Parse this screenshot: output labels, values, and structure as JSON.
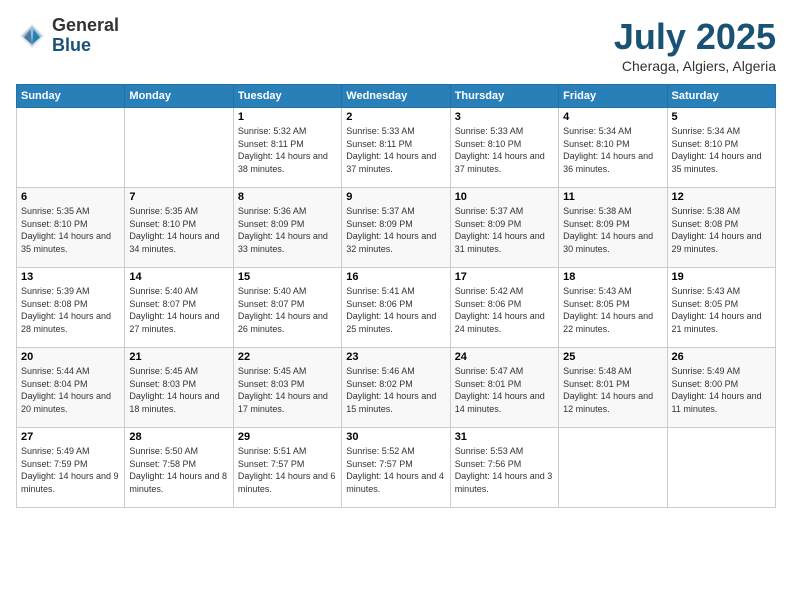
{
  "logo": {
    "general": "General",
    "blue": "Blue"
  },
  "header": {
    "month": "July 2025",
    "location": "Cheraga, Algiers, Algeria"
  },
  "weekdays": [
    "Sunday",
    "Monday",
    "Tuesday",
    "Wednesday",
    "Thursday",
    "Friday",
    "Saturday"
  ],
  "weeks": [
    [
      {
        "day": "",
        "info": ""
      },
      {
        "day": "",
        "info": ""
      },
      {
        "day": "1",
        "info": "Sunrise: 5:32 AM\nSunset: 8:11 PM\nDaylight: 14 hours and 38 minutes."
      },
      {
        "day": "2",
        "info": "Sunrise: 5:33 AM\nSunset: 8:11 PM\nDaylight: 14 hours and 37 minutes."
      },
      {
        "day": "3",
        "info": "Sunrise: 5:33 AM\nSunset: 8:10 PM\nDaylight: 14 hours and 37 minutes."
      },
      {
        "day": "4",
        "info": "Sunrise: 5:34 AM\nSunset: 8:10 PM\nDaylight: 14 hours and 36 minutes."
      },
      {
        "day": "5",
        "info": "Sunrise: 5:34 AM\nSunset: 8:10 PM\nDaylight: 14 hours and 35 minutes."
      }
    ],
    [
      {
        "day": "6",
        "info": "Sunrise: 5:35 AM\nSunset: 8:10 PM\nDaylight: 14 hours and 35 minutes."
      },
      {
        "day": "7",
        "info": "Sunrise: 5:35 AM\nSunset: 8:10 PM\nDaylight: 14 hours and 34 minutes."
      },
      {
        "day": "8",
        "info": "Sunrise: 5:36 AM\nSunset: 8:09 PM\nDaylight: 14 hours and 33 minutes."
      },
      {
        "day": "9",
        "info": "Sunrise: 5:37 AM\nSunset: 8:09 PM\nDaylight: 14 hours and 32 minutes."
      },
      {
        "day": "10",
        "info": "Sunrise: 5:37 AM\nSunset: 8:09 PM\nDaylight: 14 hours and 31 minutes."
      },
      {
        "day": "11",
        "info": "Sunrise: 5:38 AM\nSunset: 8:09 PM\nDaylight: 14 hours and 30 minutes."
      },
      {
        "day": "12",
        "info": "Sunrise: 5:38 AM\nSunset: 8:08 PM\nDaylight: 14 hours and 29 minutes."
      }
    ],
    [
      {
        "day": "13",
        "info": "Sunrise: 5:39 AM\nSunset: 8:08 PM\nDaylight: 14 hours and 28 minutes."
      },
      {
        "day": "14",
        "info": "Sunrise: 5:40 AM\nSunset: 8:07 PM\nDaylight: 14 hours and 27 minutes."
      },
      {
        "day": "15",
        "info": "Sunrise: 5:40 AM\nSunset: 8:07 PM\nDaylight: 14 hours and 26 minutes."
      },
      {
        "day": "16",
        "info": "Sunrise: 5:41 AM\nSunset: 8:06 PM\nDaylight: 14 hours and 25 minutes."
      },
      {
        "day": "17",
        "info": "Sunrise: 5:42 AM\nSunset: 8:06 PM\nDaylight: 14 hours and 24 minutes."
      },
      {
        "day": "18",
        "info": "Sunrise: 5:43 AM\nSunset: 8:05 PM\nDaylight: 14 hours and 22 minutes."
      },
      {
        "day": "19",
        "info": "Sunrise: 5:43 AM\nSunset: 8:05 PM\nDaylight: 14 hours and 21 minutes."
      }
    ],
    [
      {
        "day": "20",
        "info": "Sunrise: 5:44 AM\nSunset: 8:04 PM\nDaylight: 14 hours and 20 minutes."
      },
      {
        "day": "21",
        "info": "Sunrise: 5:45 AM\nSunset: 8:03 PM\nDaylight: 14 hours and 18 minutes."
      },
      {
        "day": "22",
        "info": "Sunrise: 5:45 AM\nSunset: 8:03 PM\nDaylight: 14 hours and 17 minutes."
      },
      {
        "day": "23",
        "info": "Sunrise: 5:46 AM\nSunset: 8:02 PM\nDaylight: 14 hours and 15 minutes."
      },
      {
        "day": "24",
        "info": "Sunrise: 5:47 AM\nSunset: 8:01 PM\nDaylight: 14 hours and 14 minutes."
      },
      {
        "day": "25",
        "info": "Sunrise: 5:48 AM\nSunset: 8:01 PM\nDaylight: 14 hours and 12 minutes."
      },
      {
        "day": "26",
        "info": "Sunrise: 5:49 AM\nSunset: 8:00 PM\nDaylight: 14 hours and 11 minutes."
      }
    ],
    [
      {
        "day": "27",
        "info": "Sunrise: 5:49 AM\nSunset: 7:59 PM\nDaylight: 14 hours and 9 minutes."
      },
      {
        "day": "28",
        "info": "Sunrise: 5:50 AM\nSunset: 7:58 PM\nDaylight: 14 hours and 8 minutes."
      },
      {
        "day": "29",
        "info": "Sunrise: 5:51 AM\nSunset: 7:57 PM\nDaylight: 14 hours and 6 minutes."
      },
      {
        "day": "30",
        "info": "Sunrise: 5:52 AM\nSunset: 7:57 PM\nDaylight: 14 hours and 4 minutes."
      },
      {
        "day": "31",
        "info": "Sunrise: 5:53 AM\nSunset: 7:56 PM\nDaylight: 14 hours and 3 minutes."
      },
      {
        "day": "",
        "info": ""
      },
      {
        "day": "",
        "info": ""
      }
    ]
  ]
}
